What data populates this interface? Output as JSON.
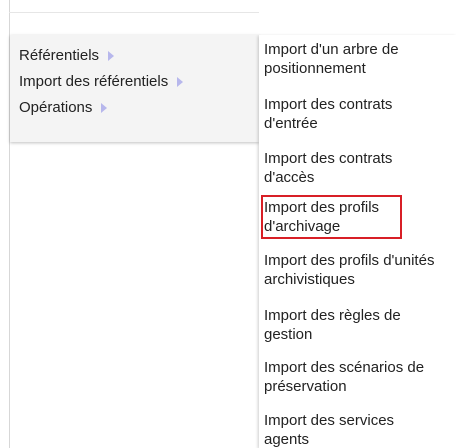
{
  "main_menu": {
    "items": [
      {
        "label": "Référentiels"
      },
      {
        "label": "Import des référentiels"
      },
      {
        "label": "Opérations"
      }
    ]
  },
  "submenu": {
    "items": [
      {
        "line1": "Import d'un arbre de",
        "line2": "positionnement"
      },
      {
        "line1": "Import des contrats",
        "line2": "d'entrée"
      },
      {
        "line1": "Import des contrats",
        "line2": "d'accès"
      },
      {
        "line1": "Import des profils",
        "line2": "d'archivage"
      },
      {
        "line1": "Import des profils d'unités",
        "line2": "archivistiques"
      },
      {
        "line1": "Import des règles de",
        "line2": "gestion"
      },
      {
        "line1": "Import des scénarios de",
        "line2": "préservation"
      },
      {
        "line1": "Import des services",
        "line2": "agents"
      }
    ]
  },
  "colors": {
    "highlight_border": "#d81f26",
    "menu_background": "#f4f4f4",
    "arrow": "#b7b7ec"
  }
}
